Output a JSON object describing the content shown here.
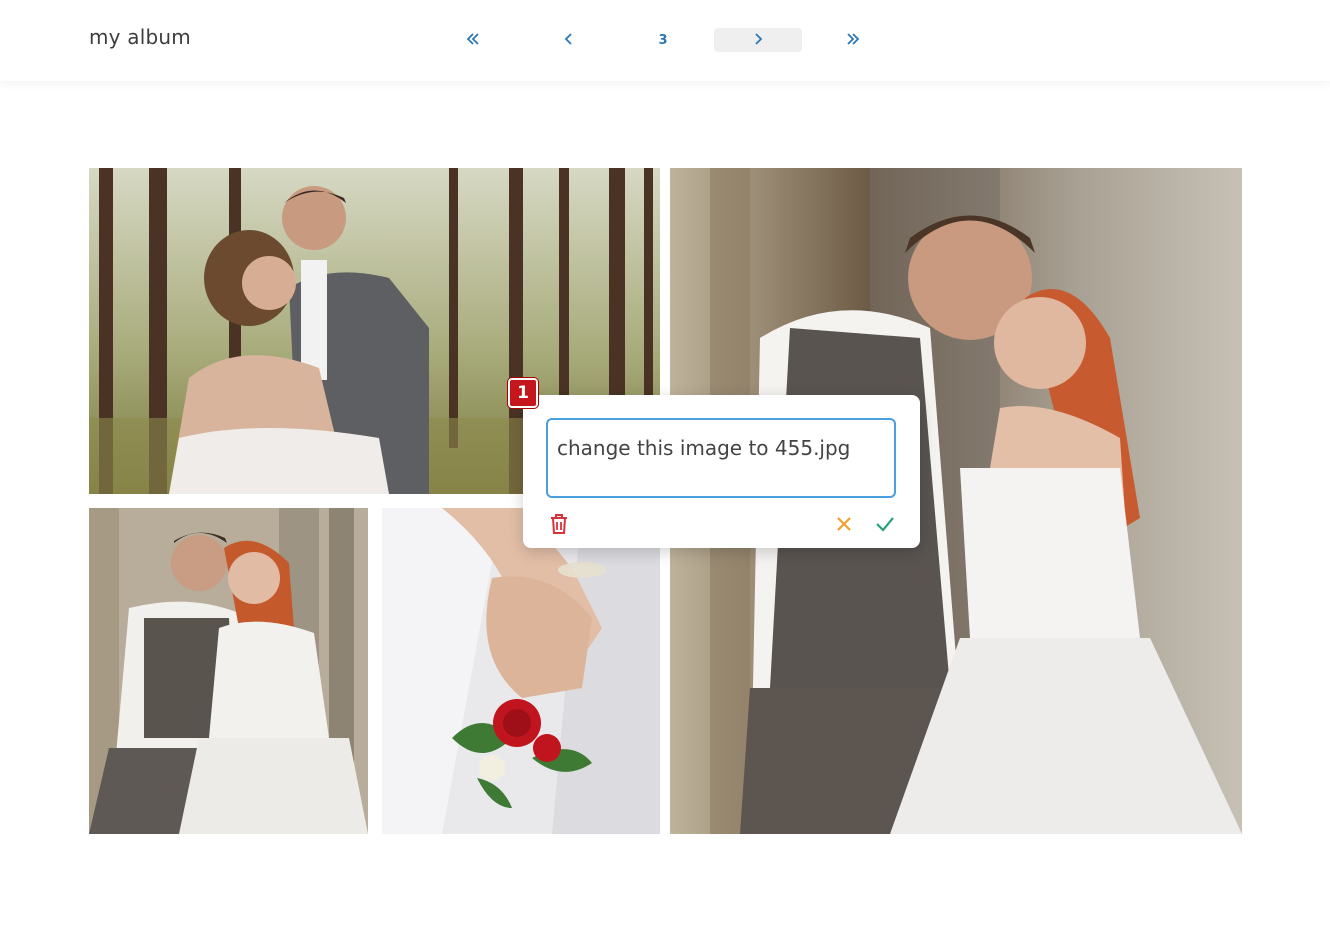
{
  "header": {
    "title": "my album"
  },
  "pagination": {
    "first_icon": "double-chevron-left-icon",
    "prev_icon": "chevron-left-icon",
    "current_page": "3",
    "next_icon": "chevron-right-icon",
    "last_icon": "double-chevron-right-icon"
  },
  "gallery": {
    "photos": [
      {
        "subject": "couple embracing in pine forest"
      },
      {
        "subject": "couple embracing near stone columns"
      },
      {
        "subject": "couple seated near columns"
      },
      {
        "subject": "bride hands with red rose boutonniere"
      }
    ]
  },
  "editor": {
    "marker": "1",
    "input_value": "change this image to 455.jpg",
    "delete_icon": "trash-icon",
    "cancel_icon": "close-icon",
    "confirm_icon": "check-icon"
  },
  "colors": {
    "accent": "#2b78b8",
    "input_border": "#4a9fe0",
    "delete": "#d9323a",
    "cancel": "#f0a030",
    "confirm": "#2aa07a",
    "marker": "#c4161c"
  }
}
